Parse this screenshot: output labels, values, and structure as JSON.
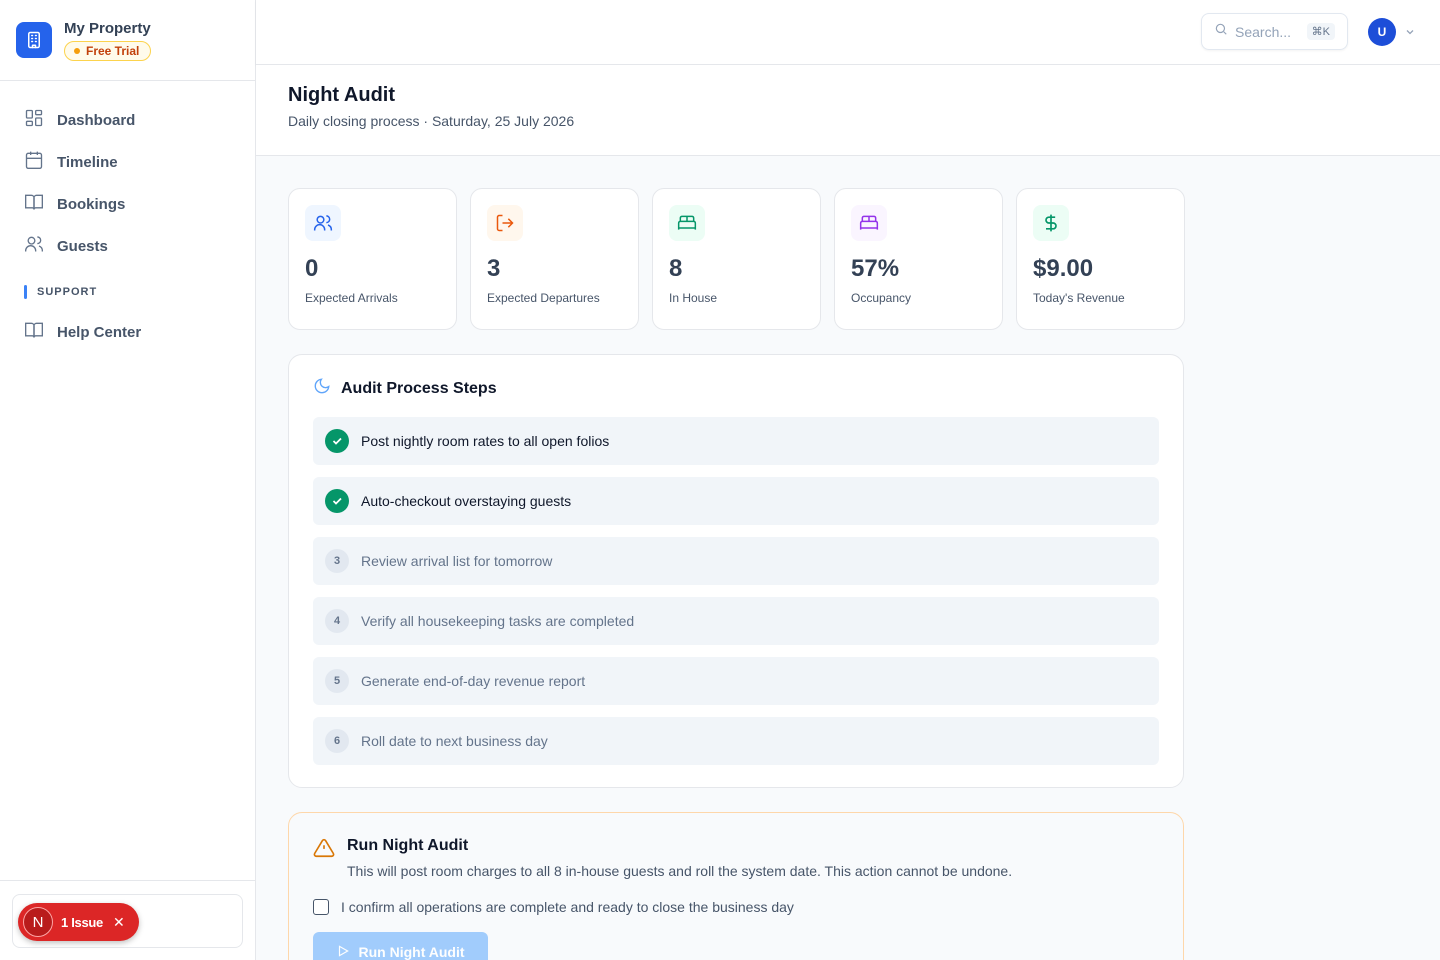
{
  "sidebar": {
    "property_name": "My Property",
    "trial_badge": "Free Trial",
    "nav": [
      {
        "label": "Dashboard",
        "icon": "dashboard-icon"
      },
      {
        "label": "Timeline",
        "icon": "calendar-icon"
      },
      {
        "label": "Bookings",
        "icon": "book-icon"
      },
      {
        "label": "Guests",
        "icon": "users-icon"
      }
    ],
    "support_section": "SUPPORT",
    "support_nav": [
      {
        "label": "Help Center",
        "icon": "book-icon"
      }
    ]
  },
  "issue_toast": {
    "avatar_letter": "N",
    "label": "1 Issue"
  },
  "header": {
    "search_placeholder": "Search...",
    "search_shortcut": "⌘K",
    "avatar_initial": "U"
  },
  "page": {
    "title": "Night Audit",
    "subtitle": "Daily closing process · Saturday, 25 July 2026"
  },
  "stats": [
    {
      "value": "0",
      "label": "Expected Arrivals",
      "icon": "users-icon",
      "color": "#2563eb",
      "bg": "#eff6ff"
    },
    {
      "value": "3",
      "label": "Expected Departures",
      "icon": "logout-icon",
      "color": "#ea580c",
      "bg": "#fff7ed"
    },
    {
      "value": "8",
      "label": "In House",
      "icon": "bed-icon",
      "color": "#059669",
      "bg": "#ecfdf5"
    },
    {
      "value": "57%",
      "label": "Occupancy",
      "icon": "bed-icon",
      "color": "#9333ea",
      "bg": "#faf5ff"
    },
    {
      "value": "$9.00",
      "label": "Today's Revenue",
      "icon": "dollar-icon",
      "color": "#059669",
      "bg": "#ecfdf5"
    }
  ],
  "steps_card": {
    "title": "Audit Process Steps",
    "steps": [
      {
        "number": "1",
        "label": "Post nightly room rates to all open folios",
        "done": true
      },
      {
        "number": "2",
        "label": "Auto-checkout overstaying guests",
        "done": true
      },
      {
        "number": "3",
        "label": "Review arrival list for tomorrow",
        "done": false
      },
      {
        "number": "4",
        "label": "Verify all housekeeping tasks are completed",
        "done": false
      },
      {
        "number": "5",
        "label": "Generate end-of-day revenue report",
        "done": false
      },
      {
        "number": "6",
        "label": "Roll date to next business day",
        "done": false
      }
    ]
  },
  "run_card": {
    "title": "Run Night Audit",
    "description": "This will post room charges to all 8 in-house guests and roll the system date. This action cannot be undone.",
    "confirm_label": "I confirm all operations are complete and ready to close the business day",
    "confirm_checked": false,
    "button_label": "Run Night Audit"
  }
}
